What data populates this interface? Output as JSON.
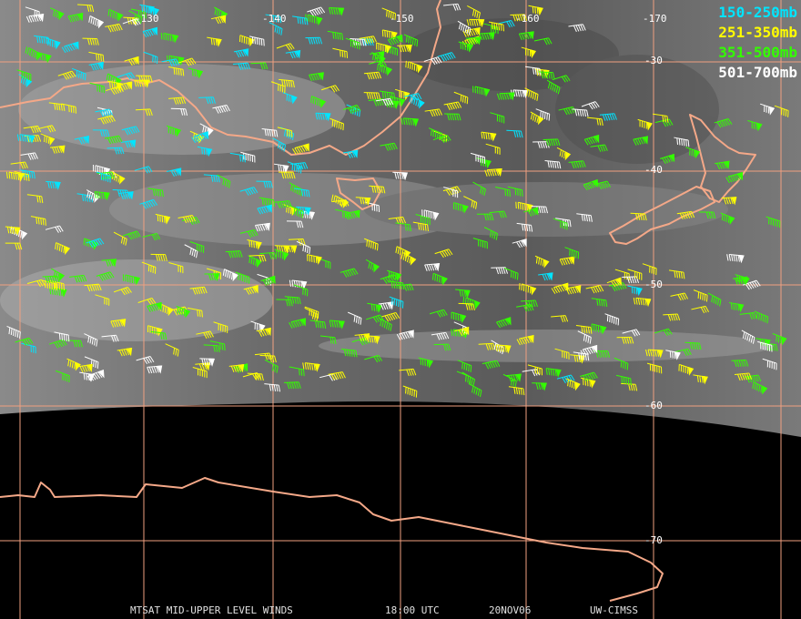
{
  "legend": [
    {
      "label": "150-250mb",
      "color": "#00e5ff"
    },
    {
      "label": "251-350mb",
      "color": "#ffff00"
    },
    {
      "label": "351-500mb",
      "color": "#33ff00"
    },
    {
      "label": "501-700mb",
      "color": "#ffffff"
    }
  ],
  "longitudes": [
    "-130",
    "-140",
    "-150",
    "-160",
    "-170"
  ],
  "latitudes": [
    "-30",
    "-40",
    "-50",
    "-60",
    "-70"
  ],
  "footer": {
    "product": "MTSAT MID-UPPER LEVEL WINDS",
    "time": "18:00 UTC",
    "date": "20NOV06",
    "source": "UW-CIMSS"
  },
  "colors": {
    "grid": "#f0a080",
    "coast": "#f4a888",
    "background": "#000000"
  }
}
